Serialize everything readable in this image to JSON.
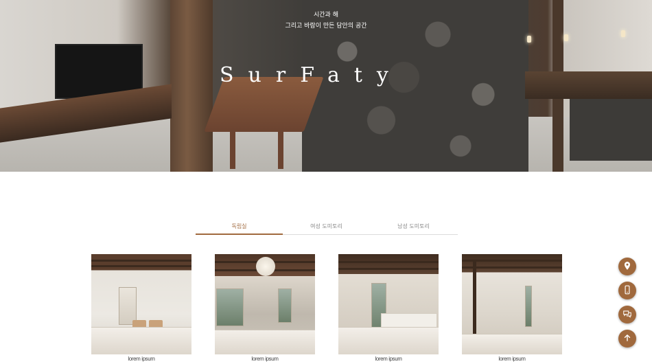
{
  "hero": {
    "subtitle_line1": "시간과 해",
    "subtitle_line2": "그리고 바람이 만든 담안의 공간",
    "brand": "SurFaty"
  },
  "tabs": [
    {
      "label": "독립실",
      "active": true
    },
    {
      "label": "여성 도미토리",
      "active": false
    },
    {
      "label": "남성 도미토리",
      "active": false
    }
  ],
  "rooms": [
    {
      "caption": "lorem ipsum"
    },
    {
      "caption": "lorem ipsum"
    },
    {
      "caption": "lorem ipsum"
    },
    {
      "caption": "lorem ipsum"
    }
  ],
  "floating_buttons": [
    {
      "icon": "location-pin-icon"
    },
    {
      "icon": "phone-icon"
    },
    {
      "icon": "chat-icon"
    },
    {
      "icon": "arrow-up-icon"
    }
  ],
  "colors": {
    "accent": "#a0693d",
    "tab_inactive": "#888888",
    "divider": "#dcdcdc"
  }
}
